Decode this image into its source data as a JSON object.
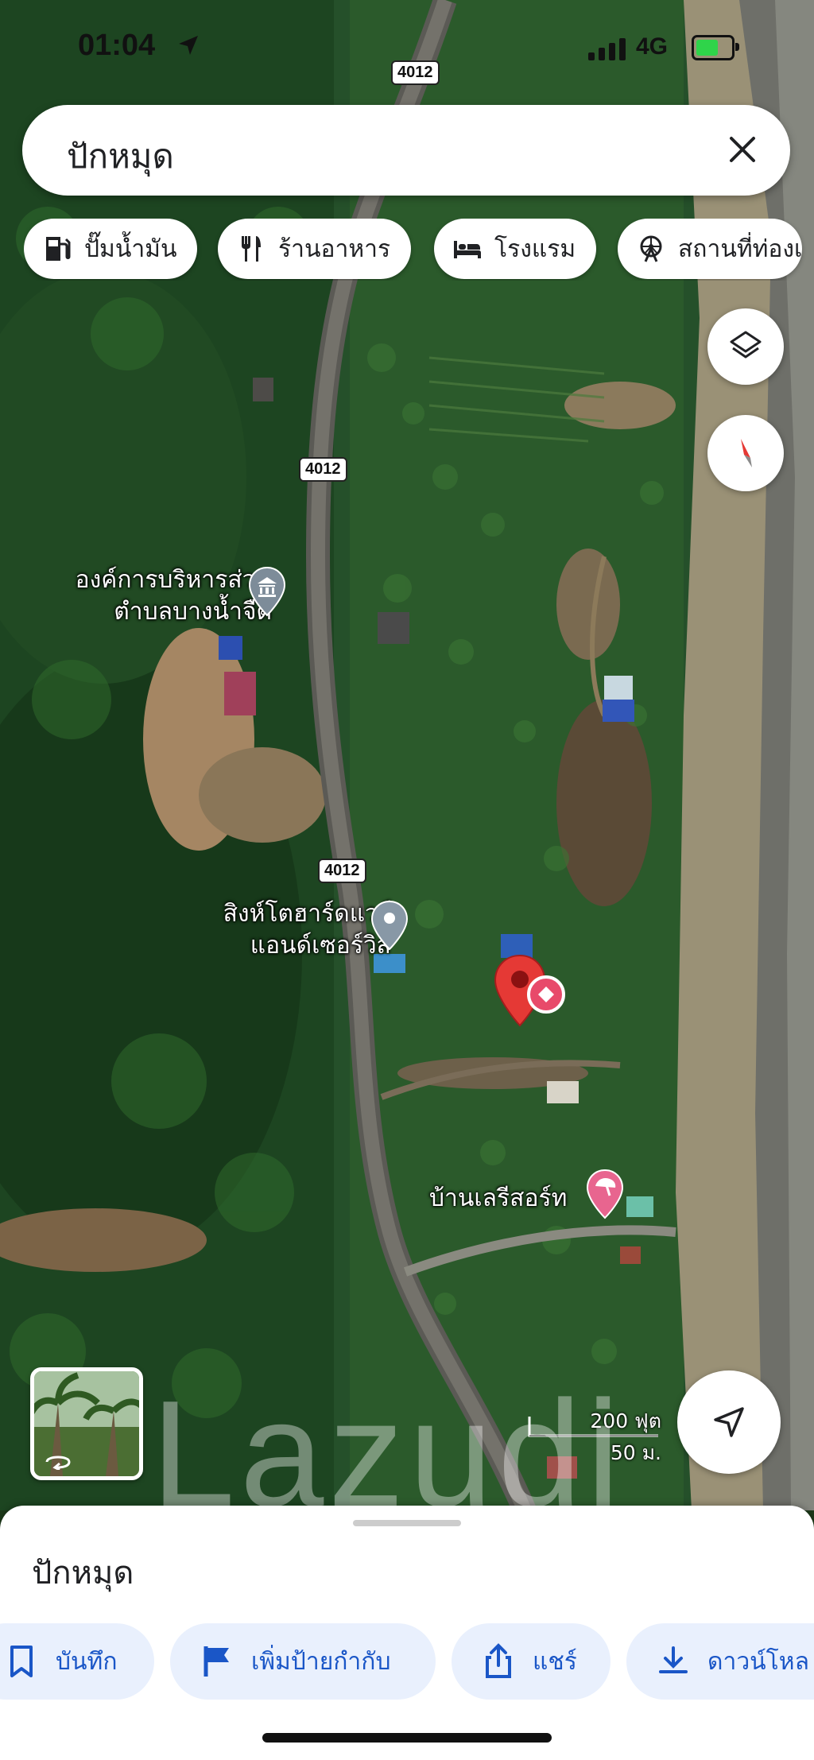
{
  "status": {
    "time": "01:04",
    "network": "4G"
  },
  "search": {
    "query": "ปักหมุด"
  },
  "chips": [
    {
      "label": "ปั๊มน้ำมัน",
      "icon": "fuel-pump-icon"
    },
    {
      "label": "ร้านอาหาร",
      "icon": "restaurant-icon"
    },
    {
      "label": "โรงแรม",
      "icon": "hotel-bed-icon"
    },
    {
      "label": "สถานที่ท่องเ",
      "icon": "attraction-icon"
    }
  ],
  "map": {
    "road_labels": [
      "4012",
      "4012",
      "4012"
    ],
    "pois": [
      {
        "line1": "องค์การบริหารส่วน",
        "line2": "ตำบลบางน้ำจืด",
        "icon": "government-building-icon"
      },
      {
        "line1": "สิงห์โตฮาร์ดแวร์",
        "line2": "แอนด์เซอร์วิส",
        "icon": "place-pin-icon"
      },
      {
        "line1": "บ้านเลรีสอร์ท",
        "icon": "resort-umbrella-icon"
      }
    ],
    "scale": {
      "imperial": "200 ฟุต",
      "metric": "50 ม."
    },
    "watermark": "Lazudi"
  },
  "sheet": {
    "title": "ปักหมุด",
    "actions": [
      {
        "label": "บันทึก",
        "icon": "bookmark-icon"
      },
      {
        "label": "เพิ่มป้ายกำกับ",
        "icon": "flag-icon"
      },
      {
        "label": "แชร์",
        "icon": "share-icon"
      },
      {
        "label": "ดาวน์โหล",
        "icon": "download-icon"
      }
    ]
  },
  "colors": {
    "accent": "#1a56c7",
    "pin": "#e53935",
    "chip_bg": "#ffffff",
    "action_bg": "#e9f0fd"
  }
}
